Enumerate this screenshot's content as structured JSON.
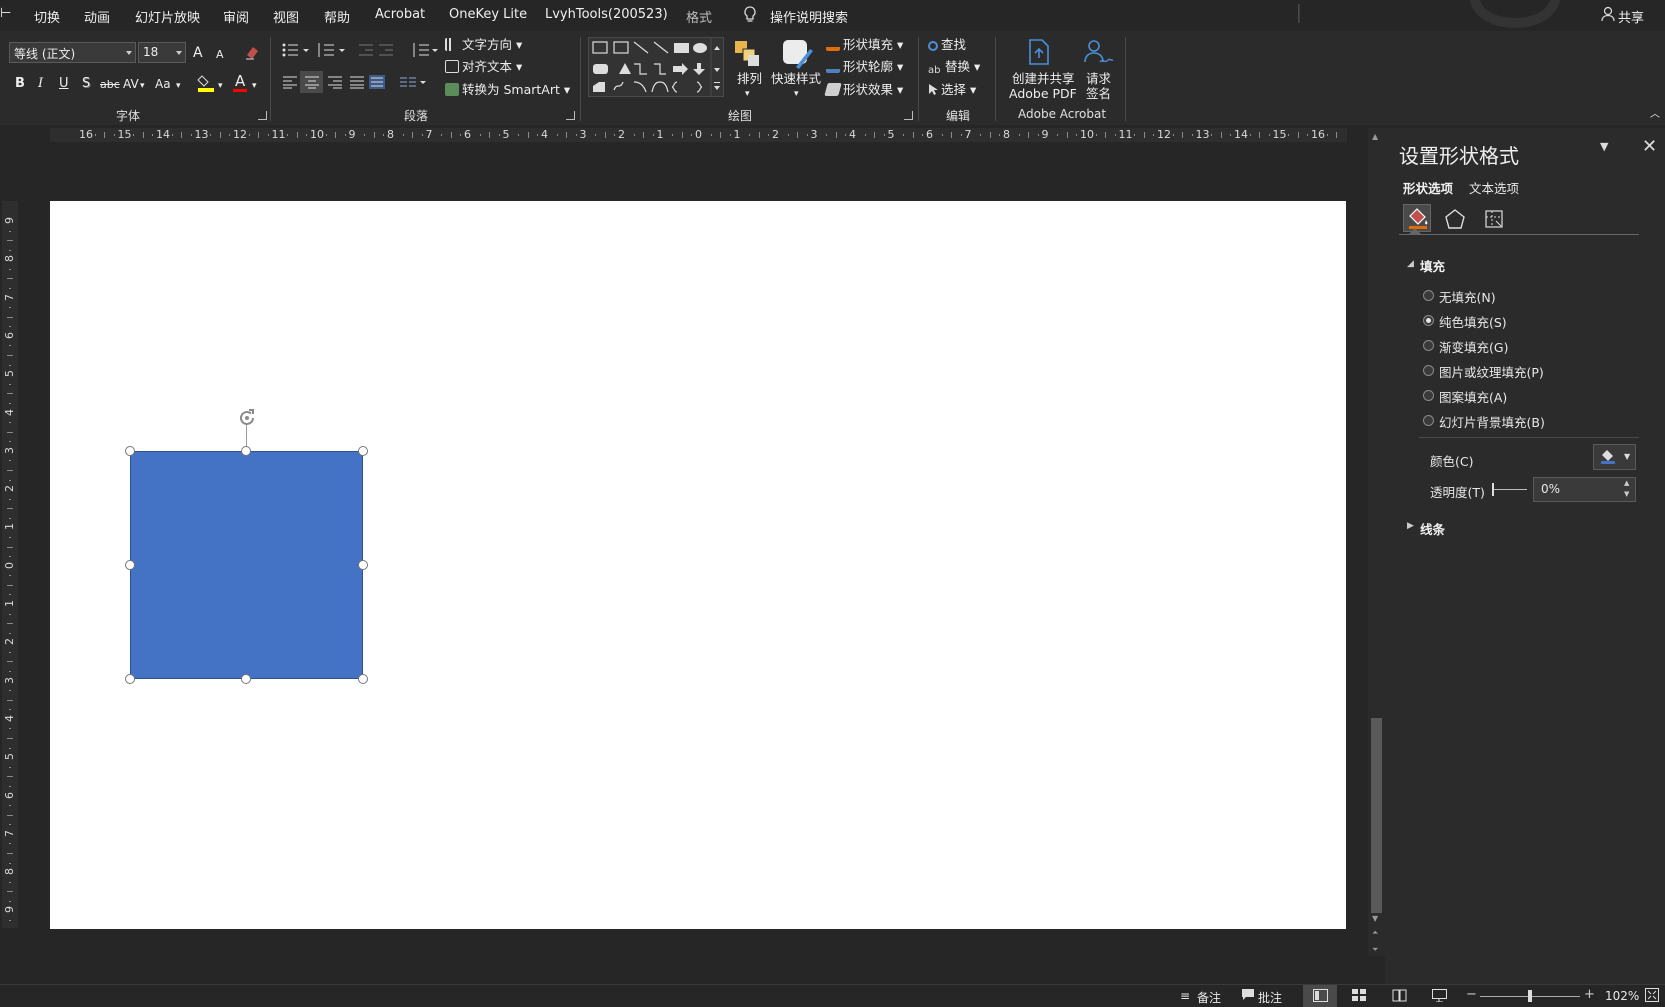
{
  "tabs": [
    "切换",
    "动画",
    "幻灯片放映",
    "审阅",
    "视图",
    "帮助",
    "Acrobat",
    "OneKey Lite",
    "LvyhTools(200523)",
    "格式"
  ],
  "tell_me": "操作说明搜索",
  "share": "共享",
  "font": {
    "name": "等线 (正文)",
    "size": "18",
    "grow": "A",
    "shrink": "A",
    "bold": "B",
    "italic": "I",
    "underline": "U",
    "shadow": "S",
    "strike": "abc",
    "spacing": "AV",
    "case": "Aa",
    "color_letter": "A",
    "group_label": "字体"
  },
  "paragraph": {
    "text_direction": "文字方向",
    "align_text": "对齐文本",
    "convert_smartart": "转换为 SmartArt",
    "group_label": "段落"
  },
  "drawing": {
    "arrange": "排列",
    "quick_styles": "快速样式",
    "shape_fill": "形状填充",
    "shape_outline": "形状轮廓",
    "shape_effects": "形状效果",
    "group_label": "绘图"
  },
  "editing": {
    "find": "查找",
    "replace": "替换",
    "select": "选择",
    "group_label": "编辑"
  },
  "acrobat": {
    "create_share_line1": "创建并共享",
    "create_share_line2": "Adobe PDF",
    "request_sign_line1": "请求",
    "request_sign_line2": "签名",
    "group_label": "Adobe Acrobat"
  },
  "ruler_h": [
    "16",
    "15",
    "14",
    "13",
    "12",
    "11",
    "10",
    "9",
    "8",
    "7",
    "6",
    "5",
    "4",
    "3",
    "2",
    "1",
    "0",
    "1",
    "2",
    "3",
    "4",
    "5",
    "6",
    "7",
    "8",
    "9",
    "10",
    "11",
    "12",
    "13",
    "14",
    "15",
    "16"
  ],
  "ruler_v": [
    "9",
    "8",
    "7",
    "6",
    "5",
    "4",
    "3",
    "2",
    "1",
    "0",
    "1",
    "2",
    "3",
    "4",
    "5",
    "6",
    "7",
    "8",
    "9"
  ],
  "shape": {
    "fill_color": "#4472c4"
  },
  "pane": {
    "title": "设置形状格式",
    "tab_shape": "形状选项",
    "tab_text": "文本选项",
    "section_fill": "填充",
    "options": [
      {
        "label": "无填充(N)",
        "selected": false
      },
      {
        "label": "纯色填充(S)",
        "selected": true
      },
      {
        "label": "渐变填充(G)",
        "selected": false
      },
      {
        "label": "图片或纹理填充(P)",
        "selected": false
      },
      {
        "label": "图案填充(A)",
        "selected": false
      },
      {
        "label": "幻灯片背景填充(B)",
        "selected": false
      }
    ],
    "color_label": "颜色(C)",
    "transparency_label": "透明度(T)",
    "transparency_value": "0%",
    "section_line": "线条"
  },
  "status": {
    "notes": "备注",
    "comments": "批注",
    "zoom": "102%"
  }
}
